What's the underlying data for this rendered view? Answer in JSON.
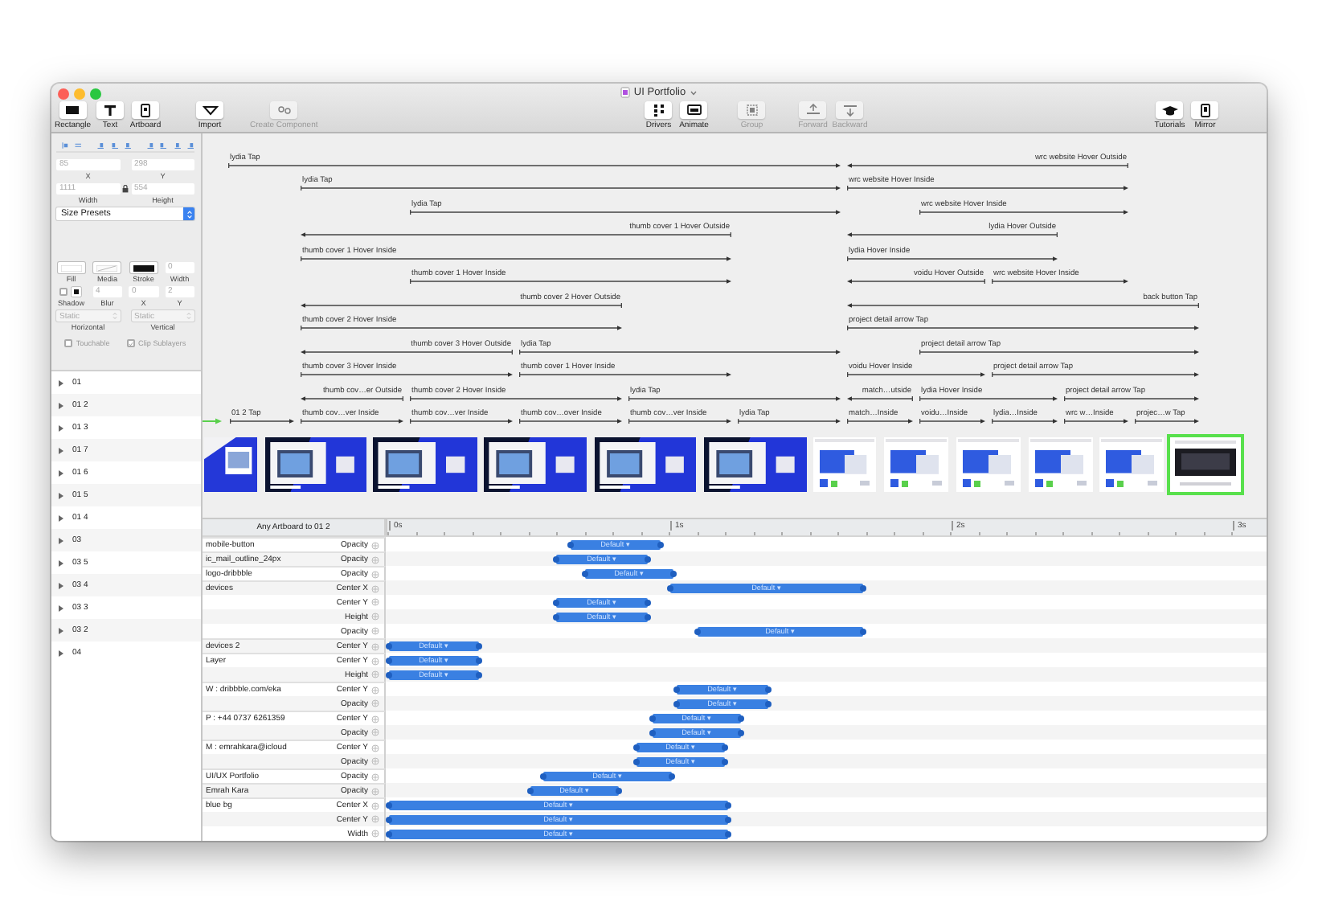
{
  "window": {
    "title": "UI Portfolio"
  },
  "toolbar_groups": [
    {
      "buttons": [
        {
          "label": "Rectangle",
          "kind": "rectangle",
          "disabled": false
        },
        {
          "label": "Text",
          "kind": "text",
          "disabled": false
        },
        {
          "label": "Artboard",
          "kind": "artboard",
          "disabled": false
        }
      ]
    },
    {
      "buttons": [
        {
          "label": "Import",
          "kind": "import",
          "disabled": false
        }
      ]
    },
    {
      "buttons": [
        {
          "label": "Create Component",
          "kind": "component",
          "disabled": true
        }
      ]
    },
    {
      "buttons": [
        {
          "label": "Drivers",
          "kind": "drivers",
          "disabled": false
        },
        {
          "label": "Animate",
          "kind": "animate",
          "disabled": false
        }
      ]
    },
    {
      "buttons": [
        {
          "label": "Group",
          "kind": "group",
          "disabled": true
        }
      ]
    },
    {
      "buttons": [
        {
          "label": "Forward",
          "kind": "forward",
          "disabled": true
        },
        {
          "label": "Backward",
          "kind": "backward",
          "disabled": true
        }
      ]
    },
    {
      "buttons": [
        {
          "label": "Tutorials",
          "kind": "tutorials",
          "disabled": false
        },
        {
          "label": "Mirror",
          "kind": "mirror",
          "disabled": false
        }
      ]
    }
  ],
  "inspector": {
    "position": [
      {
        "value": "85",
        "label": "X"
      },
      {
        "value": "298",
        "label": "Y"
      }
    ],
    "size": [
      {
        "value": "1111",
        "label": "Width"
      },
      {
        "value": "554",
        "label": "Height"
      }
    ],
    "size_presets": "Size Presets",
    "appearance": [
      {
        "kind": "fill",
        "label": "Fill"
      },
      {
        "kind": "media",
        "label": "Media"
      },
      {
        "kind": "stroke",
        "label": "Stroke"
      },
      {
        "kind": "field",
        "value": "0",
        "label": "Width"
      }
    ],
    "shadow": [
      {
        "kind": "shadow",
        "label": "Shadow",
        "checked": false
      },
      {
        "kind": "field",
        "value": "4",
        "label": "Blur"
      },
      {
        "kind": "field",
        "value": "0",
        "label": "X"
      },
      {
        "kind": "field",
        "value": "2",
        "label": "Y"
      }
    ],
    "resizing": [
      {
        "value": "Static",
        "label": "Horizontal"
      },
      {
        "value": "Static",
        "label": "Vertical"
      }
    ],
    "options": [
      {
        "label": "Touchable",
        "checked": false,
        "disabled": true
      },
      {
        "label": "Clip Sublayers",
        "checked": true,
        "disabled": true
      }
    ]
  },
  "layers": [
    {
      "name": "01",
      "expanded": false
    },
    {
      "name": "01 2",
      "expanded": false
    },
    {
      "name": "01 3",
      "expanded": false
    },
    {
      "name": "01 7",
      "expanded": false
    },
    {
      "name": "01 6",
      "expanded": false
    },
    {
      "name": "01 5",
      "expanded": false
    },
    {
      "name": "01 4",
      "expanded": false
    },
    {
      "name": "03",
      "expanded": false
    },
    {
      "name": "03 5",
      "expanded": false
    },
    {
      "name": "03 4",
      "expanded": false
    },
    {
      "name": "03 3",
      "expanded": false
    },
    {
      "name": "03 2",
      "expanded": false
    },
    {
      "name": "04",
      "expanded": false
    }
  ],
  "connection_rows": [
    [
      {
        "label": "lydia Tap",
        "kind": "forward"
      },
      {
        "label": "wrc website Hover Outside",
        "kind": "back"
      }
    ],
    [
      {
        "label": "lydia Tap",
        "kind": "forward"
      },
      {
        "label": "wrc website Hover Inside",
        "kind": "forward"
      }
    ],
    [
      {
        "label": "lydia Tap",
        "kind": "forward"
      },
      {
        "label": "wrc website Hover Inside",
        "kind": "forward"
      }
    ],
    [
      {
        "label": "thumb cover 1 Hover Outside",
        "kind": "back"
      },
      {
        "label": "lydia Hover Outside",
        "kind": "back"
      }
    ],
    [
      {
        "label": "thumb cover 1 Hover Inside",
        "kind": "forward"
      },
      {
        "label": "lydia Hover Inside",
        "kind": "forward"
      }
    ],
    [
      {
        "label": "thumb cover 1 Hover Inside",
        "kind": "forward"
      },
      {
        "label": "voidu Hover Outside",
        "kind": "back"
      },
      {
        "label": "wrc website Hover Inside",
        "kind": "forward"
      }
    ],
    [
      {
        "label": "thumb cover 2 Hover Outside",
        "kind": "back"
      },
      {
        "label": "back button Tap",
        "kind": "back"
      }
    ],
    [
      {
        "label": "thumb cover 2 Hover Inside",
        "kind": "forward"
      },
      {
        "label": "project detail arrow Tap",
        "kind": "forward"
      }
    ],
    [
      {
        "label": "thumb cover 3 Hover Outside",
        "kind": "back"
      },
      {
        "label": "lydia Tap",
        "kind": "forward"
      },
      {
        "label": "project detail arrow Tap",
        "kind": "forward"
      }
    ],
    [
      {
        "label": "thumb cover 3 Hover Inside",
        "kind": "forward"
      },
      {
        "label": "thumb cover 1 Hover Inside",
        "kind": "forward"
      },
      {
        "label": "voidu Hover Inside",
        "kind": "forward"
      },
      {
        "label": "project detail arrow Tap",
        "kind": "forward"
      }
    ],
    [
      {
        "label": "thumb cov…er Outside",
        "kind": "back"
      },
      {
        "label": "thumb cover 2 Hover Inside",
        "kind": "forward"
      },
      {
        "label": "lydia Tap",
        "kind": "forward"
      },
      {
        "label": "match…utside",
        "kind": "back"
      },
      {
        "label": "lydia Hover Inside",
        "kind": "forward"
      },
      {
        "label": "project detail arrow Tap",
        "kind": "forward"
      }
    ],
    [
      {
        "label": "01 2 Tap",
        "kind": "forward"
      },
      {
        "label": "thumb cov…ver Inside",
        "kind": "forward"
      },
      {
        "label": "thumb cov…ver Inside",
        "kind": "forward"
      },
      {
        "label": "thumb cov…over Inside",
        "kind": "forward"
      },
      {
        "label": "thumb cov…ver Inside",
        "kind": "forward"
      },
      {
        "label": "lydia Tap",
        "kind": "forward"
      },
      {
        "label": "match…Inside",
        "kind": "forward"
      },
      {
        "label": "voidu…Inside",
        "kind": "forward"
      },
      {
        "label": "lydia…Inside",
        "kind": "forward"
      },
      {
        "label": "wrc w…Inside",
        "kind": "forward"
      },
      {
        "label": "projec…w Tap",
        "kind": "forward"
      }
    ]
  ],
  "artboards": [
    {
      "kind": "narrow",
      "selected": false
    },
    {
      "kind": "wide",
      "selected": false
    },
    {
      "kind": "wide",
      "selected": false
    },
    {
      "kind": "wide",
      "selected": false
    },
    {
      "kind": "wide",
      "selected": false
    },
    {
      "kind": "wide",
      "selected": false
    },
    {
      "kind": "mobile",
      "selected": false
    },
    {
      "kind": "mobile",
      "selected": false
    },
    {
      "kind": "mobile",
      "selected": false
    },
    {
      "kind": "mobile",
      "selected": false
    },
    {
      "kind": "mobile",
      "selected": false
    },
    {
      "kind": "dark",
      "selected": true
    }
  ],
  "timeline": {
    "title": "Any Artboard to 01 2",
    "ruler": [
      "0s",
      "1s",
      "2s",
      "3s"
    ],
    "tracks": [
      {
        "layer": "mobile-button",
        "properties": [
          {
            "name": "Opacity",
            "curve": "Default ▾"
          }
        ]
      },
      {
        "layer": "ic_mail_outline_24px",
        "properties": [
          {
            "name": "Opacity",
            "curve": "Default ▾"
          }
        ]
      },
      {
        "layer": "logo-dribbble",
        "properties": [
          {
            "name": "Opacity",
            "curve": "Default ▾"
          }
        ]
      },
      {
        "layer": "devices",
        "properties": [
          {
            "name": "Center X",
            "curve": "Default ▾"
          },
          {
            "name": "Center Y",
            "curve": "Default ▾"
          },
          {
            "name": "Height",
            "curve": "Default ▾"
          },
          {
            "name": "Opacity",
            "curve": "Default ▾"
          }
        ]
      },
      {
        "layer": "devices 2",
        "properties": [
          {
            "name": "Center Y",
            "curve": "Default ▾"
          }
        ]
      },
      {
        "layer": "Layer",
        "properties": [
          {
            "name": "Center Y",
            "curve": "Default ▾"
          },
          {
            "name": "Height",
            "curve": "Default ▾"
          }
        ]
      },
      {
        "layer": "W : dribbble.com/eka",
        "properties": [
          {
            "name": "Center Y",
            "curve": "Default ▾"
          },
          {
            "name": "Opacity",
            "curve": "Default ▾"
          }
        ]
      },
      {
        "layer": "P : +44 0737 6261359",
        "properties": [
          {
            "name": "Center Y",
            "curve": "Default ▾"
          },
          {
            "name": "Opacity",
            "curve": "Default ▾"
          }
        ]
      },
      {
        "layer": "M : emrahkara@icloud",
        "properties": [
          {
            "name": "Center Y",
            "curve": "Default ▾"
          },
          {
            "name": "Opacity",
            "curve": "Default ▾"
          }
        ]
      },
      {
        "layer": "UI/UX Portfolio",
        "properties": [
          {
            "name": "Opacity",
            "curve": "Default ▾"
          }
        ]
      },
      {
        "layer": "Emrah Kara",
        "properties": [
          {
            "name": "Opacity",
            "curve": "Default ▾"
          }
        ]
      },
      {
        "layer": "blue bg",
        "properties": [
          {
            "name": "Center X",
            "curve": "Default ▾"
          },
          {
            "name": "Center Y",
            "curve": "Default ▾"
          },
          {
            "name": "Width",
            "curve": "Default ▾"
          }
        ]
      }
    ]
  }
}
